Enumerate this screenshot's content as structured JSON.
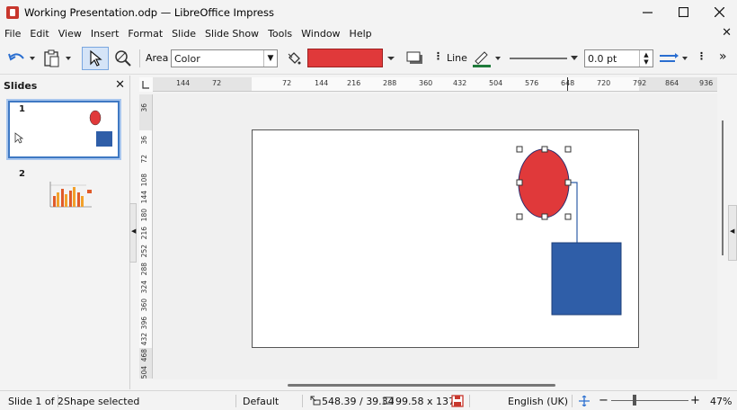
{
  "window": {
    "title": "Working Presentation.odp — LibreOffice Impress"
  },
  "menu": [
    "File",
    "Edit",
    "View",
    "Insert",
    "Format",
    "Slide",
    "Slide Show",
    "Tools",
    "Window",
    "Help"
  ],
  "toolbar": {
    "area_label": "Area",
    "area_fill": "Color",
    "fill_color": "#e0393a",
    "line_label": "Line",
    "line_width": "0.0 pt"
  },
  "slides_panel": {
    "title": "Slides",
    "slides": [
      {
        "number": "1"
      },
      {
        "number": "2"
      }
    ]
  },
  "rulers": {
    "horizontal": [
      "144",
      "72",
      "72",
      "144",
      "216",
      "288",
      "360",
      "432",
      "504",
      "576",
      "648",
      "720",
      "792",
      "864",
      "936"
    ],
    "vertical": [
      "36",
      "36",
      "72",
      "108",
      "144",
      "180",
      "216",
      "252",
      "288",
      "324",
      "360",
      "396",
      "432",
      "468",
      "504"
    ]
  },
  "slide": {
    "ellipse_color": "#e0393a",
    "rect_color": "#2f5ea8"
  },
  "status": {
    "slide_info": "Slide 1 of 2",
    "selection": "Shape selected",
    "layout": "Default",
    "position": "548.39 / 39.34",
    "size": "99.58 x 137.7",
    "language": "English (UK)",
    "zoom": "47%"
  }
}
